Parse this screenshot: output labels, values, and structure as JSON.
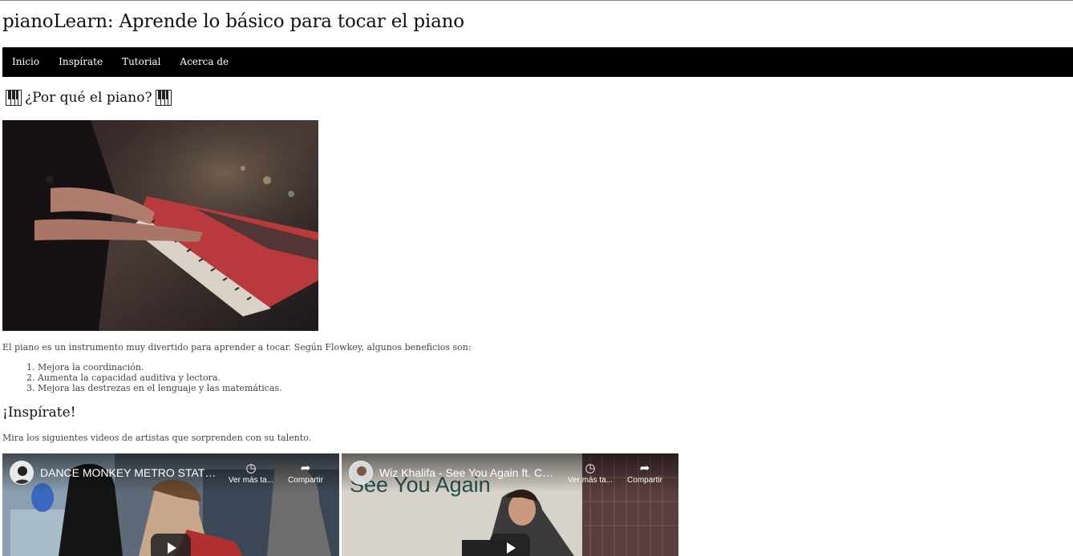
{
  "site": {
    "title": "pianoLearn: Aprende lo básico para tocar el piano"
  },
  "nav": {
    "items": [
      "Inicio",
      "Inspírate",
      "Tutorial",
      "Acerca de"
    ]
  },
  "why": {
    "heading": "¿Por qué el piano?",
    "intro": "El piano es un instrumento muy divertido para aprender a tocar. Según Flowkey, algunos beneficios son:",
    "benefits": [
      "1. Mejora la coordinación.",
      "2. Aumenta la capacidad auditiva y lectora.",
      "3. Mejora las destrezas en el lenguaje y las matemáticas."
    ]
  },
  "inspire": {
    "heading": "¡Inspírate!",
    "description": "Mira los siguientes videos de artistas que sorprenden con su talento.",
    "videos": [
      {
        "title": "DANCE MONKEY METRO STATION ...",
        "watch_later": "Ver más ta...",
        "share": "Compartir",
        "overlay": ""
      },
      {
        "title": "Wiz Khalifa - See You Again ft. Charli...",
        "watch_later": "Ver más ta...",
        "share": "Compartir",
        "overlay": "See You Again"
      }
    ]
  },
  "colors": {
    "navbar_bg": "#000000",
    "nav_text": "#ffffff",
    "page_bg": "#ffffff"
  },
  "icons": {
    "heading_icon": "piano-keys-icon",
    "watch_later": "clock-icon",
    "share": "share-arrow-icon",
    "play": "play-icon"
  }
}
